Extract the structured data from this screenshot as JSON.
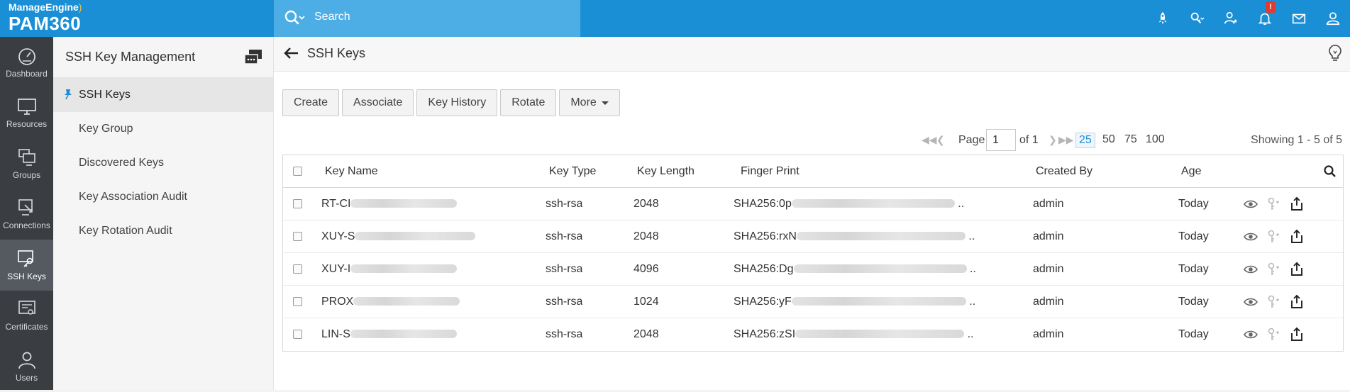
{
  "brand": {
    "company": "ManageEngine",
    "product": "PAM360"
  },
  "search": {
    "placeholder": "Search"
  },
  "top_icons": [
    {
      "name": "rocket-icon"
    },
    {
      "name": "key-dropdown-icon"
    },
    {
      "name": "user-star-icon"
    },
    {
      "name": "bell-icon",
      "badge": "!"
    },
    {
      "name": "mail-icon"
    },
    {
      "name": "user-profile-icon"
    }
  ],
  "left_nav": [
    {
      "label": "Dashboard",
      "icon": "dashboard-icon"
    },
    {
      "label": "Resources",
      "icon": "monitor-icon"
    },
    {
      "label": "Groups",
      "icon": "groups-icon"
    },
    {
      "label": "Connections",
      "icon": "connections-icon"
    },
    {
      "label": "SSH Keys",
      "icon": "ssh-key-icon",
      "active": true
    },
    {
      "label": "Certificates",
      "icon": "certificate-icon"
    },
    {
      "label": "Users",
      "icon": "users-icon"
    }
  ],
  "module": {
    "title": "SSH Key Management",
    "items": [
      {
        "label": "SSH Keys",
        "active": true
      },
      {
        "label": "Key Group"
      },
      {
        "label": "Discovered Keys"
      },
      {
        "label": "Key Association Audit"
      },
      {
        "label": "Key Rotation Audit"
      }
    ]
  },
  "main": {
    "title": "SSH Keys",
    "buttons": [
      "Create",
      "Associate",
      "Key History",
      "Rotate",
      "More"
    ]
  },
  "pager": {
    "page_label": "Page",
    "page_value": "1",
    "of_label": "of 1",
    "sizes": [
      "25",
      "50",
      "75",
      "100"
    ],
    "selected_size": "25",
    "showing": "Showing 1 - 5 of 5"
  },
  "table": {
    "columns": [
      "Key Name",
      "Key Type",
      "Key Length",
      "Finger Print",
      "Created By",
      "Age"
    ],
    "rows": [
      {
        "key_name": "RT-CI",
        "key_type": "ssh-rsa",
        "key_length": "2048",
        "finger_print": "SHA256:0p",
        "created_by": "admin",
        "age": "Today"
      },
      {
        "key_name": "XUY-S",
        "key_type": "ssh-rsa",
        "key_length": "2048",
        "finger_print": "SHA256:rxN",
        "created_by": "admin",
        "age": "Today"
      },
      {
        "key_name": "XUY-I",
        "key_type": "ssh-rsa",
        "key_length": "4096",
        "finger_print": "SHA256:Dg",
        "created_by": "admin",
        "age": "Today"
      },
      {
        "key_name": "PROX",
        "key_type": "ssh-rsa",
        "key_length": "1024",
        "finger_print": "SHA256:yF",
        "created_by": "admin",
        "age": "Today"
      },
      {
        "key_name": "LIN-S",
        "key_type": "ssh-rsa",
        "key_length": "2048",
        "finger_print": "SHA256:zSI",
        "created_by": "admin",
        "age": "Today"
      }
    ]
  },
  "colors": {
    "topbar": "#1a8fd6",
    "search_bg": "#4daee6",
    "left_nav": "#3a3d42",
    "badge": "#e03b2f"
  }
}
